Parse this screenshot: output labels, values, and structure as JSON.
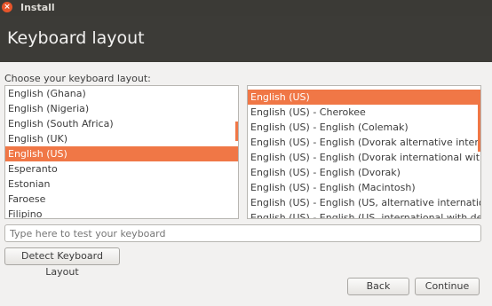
{
  "window": {
    "title": "Install"
  },
  "header": {
    "title": "Keyboard layout"
  },
  "layout_prompt": "Choose your keyboard layout:",
  "layouts": {
    "items": [
      "English (Ghana)",
      "English (Nigeria)",
      "English (South Africa)",
      "English (UK)",
      "English (US)",
      "Esperanto",
      "Estonian",
      "Faroese",
      "Filipino"
    ],
    "selected": "English (US)"
  },
  "variants": {
    "items": [
      "English (US)",
      "English (US) - Cherokee",
      "English (US) - English (Colemak)",
      "English (US) - English (Dvorak alternative international",
      "English (US) - English (Dvorak international with dead",
      "English (US) - English (Dvorak)",
      "English (US) - English (Macintosh)",
      "English (US) - English (US, alternative international)",
      "English (US) - English (US, international with dead key"
    ],
    "selected": "English (US)"
  },
  "test_field": {
    "placeholder": "Type here to test your keyboard",
    "value": ""
  },
  "buttons": {
    "detect": "Detect Keyboard Layout",
    "back": "Back",
    "continue": "Continue"
  },
  "colors": {
    "accent": "#f07746",
    "titlebar": "#3b3a36",
    "background": "#f2f1f0"
  }
}
